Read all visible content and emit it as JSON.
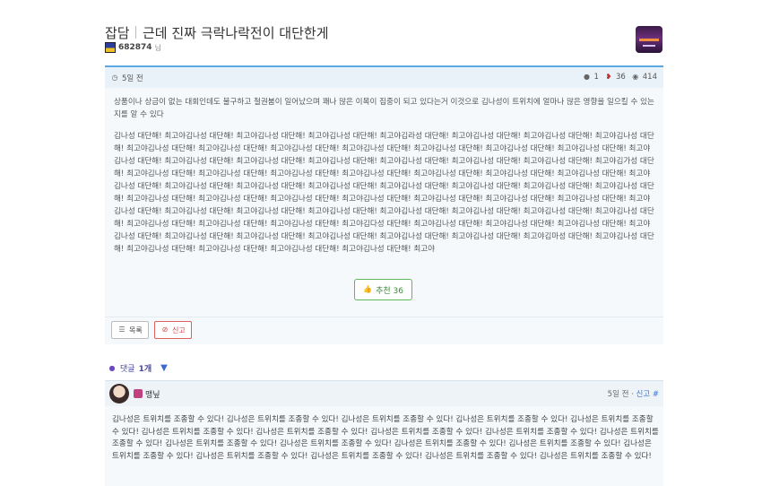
{
  "post": {
    "category": "잡담",
    "title": "근데 진짜 극락나락전이 대단한게",
    "author": "682874",
    "author_suffix": "님",
    "time": "5일 전",
    "comment_count": "1",
    "upvotes": "36",
    "views": "414",
    "intro": "상품이나 상금이 없는 대회인데도 불구하고 철권붐이 일어났으며 꽤나 많은 이목이 집중이 되고 있다는거 이것으로 김나성이 트위치에 얼마나 많은 영향을 일으킬 수 있는지를 알 수 있다",
    "body": "김나성 대단해! 최고야김나성 대단해! 최고야김나성 대단해! 최고야김나성 대단해! 최고야김라성 대단해! 최고야김나성 대단해! 최고야김나성 대단해! 최고야김나성 대단해! 최고야김나성 대단해! 최고야김나성 대단해! 최고야김나성 대단해! 최고야김나성 대단해! 최고야김나성 대단해! 최고야김나성 대단해! 최고야김나성 대단해! 최고야김나성 대단해! 최고야김나성 대단해! 최고야김나성 대단해! 최고야김나성 대단해! 최고야김나성 대단해! 최고야김나성 대단해! 최고야김나성 대단해! 최고야김가성 대단해! 최고야김나성 대단해! 최고야김나성 대단해! 최고야김나성 대단해! 최고야김나성 대단해! 최고야김나성 대단해! 최고야김나성 대단해! 최고야김나성 대단해! 최고야김나성 대단해! 최고야김나성 대단해! 최고야김나성 대단해! 최고야김나성 대단해! 최고야김나성 대단해! 최고야김나성 대단해! 최고야김나성 대단해! 최고야김나성 대단해! 최고야김나성 대단해! 최고야김나성 대단해! 최고야김나성 대단해! 최고야김나성 대단해! 최고야김나성 대단해! 최고야김나성 대단해! 최고야김나성 대단해! 최고야김나성 대단해! 최고야김나성 대단해! 최고야김나성 대단해! 최고야김나성 대단해! 최고야김나성 대단해! 최고야김나성 대단해! 최고야김나성 대단해! 최고야김나성 대단해! 최고야김나성 대단해! 최고야김나성 대단해! 최고야김나성 대단해! 최고야김다성 대단해! 최고야김나성 대단해! 최고야김나성 대단해! 최고야김나성 대단해! 최고야김나성 대단해! 최고야김나성 대단해! 최고야김나성 대단해! 최고야김나성 대단해! 최고야김나성 대단해! 최고야김나성 대단해! 최고야김마성 대단해! 최고야김나성 대단해! 최고야김나성 대단해! 최고야김나성 대단해! 최고야김나성 대단해! 최고야김나성 대단해! 최고야",
    "recommend_label": "추천 36"
  },
  "actions": {
    "list_label": "목록",
    "report_label": "신고"
  },
  "comments": {
    "header": "댓글",
    "count": "1개",
    "items": [
      {
        "nick": "맹닢",
        "time": "5일 전",
        "report": "신고",
        "hash": "#",
        "body": "김나성은 트위치를 조종할 수 있다! 김나성은 트위치를 조종할 수 있다! 김나성은 트위치를 조종할 수 있다! 김나성은 트위치를 조종할 수 있다! 김나성은 트위치를 조종할 수 있다! 김나성은 트위치를 조종할 수 있다! 김나성은 트위치를 조종할 수 있다! 김나성은 트위치를 조종할 수 있다! 김나성은 트위치를 조종할 수 있다! 김나성은 트위치를 조종할 수 있다! 김나성은 트위치를 조종할 수 있다! 김나성은 트위치를 조종할 수 있다! 김나성은 트위치를 조종할 수 있다! 김나성은 트위치를 조종할 수 있다! 김나성은 트위치를 조종할 수 있다! 김나성은 트위치를 조종할 수 있다! 김나성은 트위치를 조종할 수 있다! 김나성은 트위치를 조종할 수 있다! 김나성은 트위치를 조종할 수 있다!"
      }
    ]
  }
}
